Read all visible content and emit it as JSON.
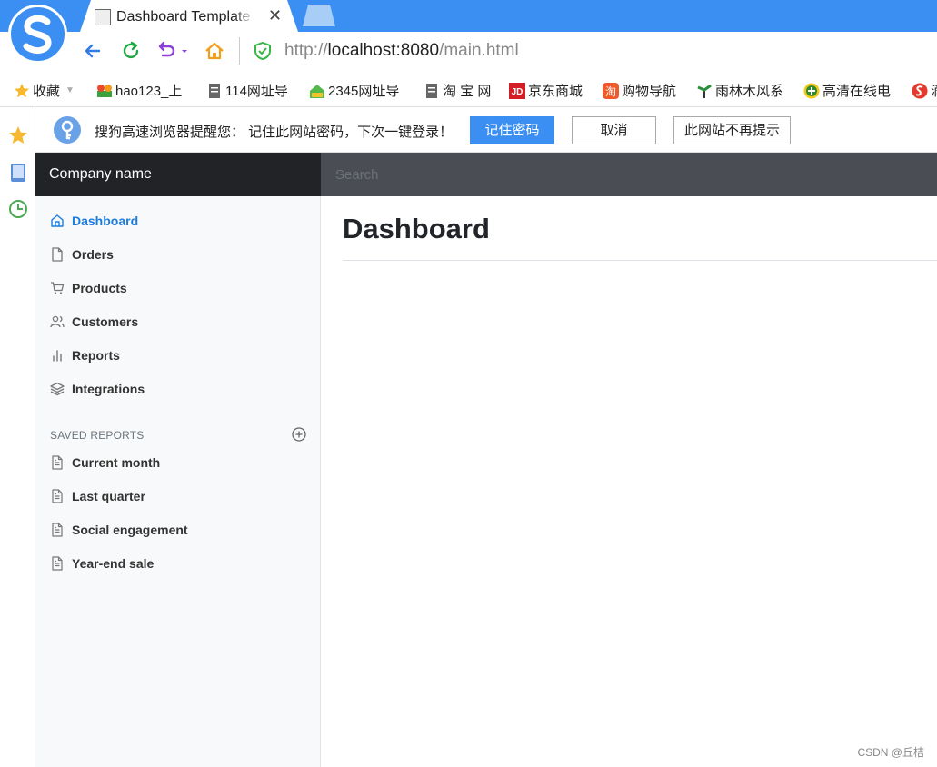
{
  "browser": {
    "tab_title": "Dashboard Template f",
    "tab_close": "✕",
    "url_scheme": "http://",
    "url_host": "localhost:8080",
    "url_path": "/main.html"
  },
  "bookmarks": [
    {
      "label": "收藏",
      "icon": "star-icon"
    },
    {
      "label": "hao123_上",
      "icon": "hao123-icon"
    },
    {
      "label": "114网址导",
      "icon": "page-icon"
    },
    {
      "label": "2345网址导",
      "icon": "house-2345-icon"
    },
    {
      "label": "淘 宝 网",
      "icon": "page-icon"
    },
    {
      "label": "京东商城",
      "icon": "jd-icon"
    },
    {
      "label": "购物导航",
      "icon": "taobao-icon"
    },
    {
      "label": "雨林木风系",
      "icon": "tree-icon"
    },
    {
      "label": "高清在线电",
      "icon": "plus-circle-icon"
    },
    {
      "label": "滴",
      "icon": "sogou-icon"
    }
  ],
  "password_bar": {
    "message": "搜狗高速浏览器提醒您： 记住此网站密码，下次一键登录！",
    "remember_label": "记住密码",
    "cancel_label": "取消",
    "never_label": "此网站不再提示"
  },
  "page": {
    "brand": "Company name",
    "search_placeholder": "Search",
    "title": "Dashboard",
    "accent_color": "#1a7dde"
  },
  "sidebar": {
    "items": [
      {
        "label": "Dashboard",
        "icon": "home-icon",
        "active": true
      },
      {
        "label": "Orders",
        "icon": "file-icon"
      },
      {
        "label": "Products",
        "icon": "shopping-cart-icon"
      },
      {
        "label": "Customers",
        "icon": "users-icon"
      },
      {
        "label": "Reports",
        "icon": "bar-chart-icon"
      },
      {
        "label": "Integrations",
        "icon": "layers-icon"
      }
    ],
    "saved_heading": "SAVED REPORTS",
    "saved": [
      {
        "label": "Current month",
        "icon": "file-text-icon"
      },
      {
        "label": "Last quarter",
        "icon": "file-text-icon"
      },
      {
        "label": "Social engagement",
        "icon": "file-text-icon"
      },
      {
        "label": "Year-end sale",
        "icon": "file-text-icon"
      }
    ]
  },
  "watermark": "CSDN @丘桔"
}
